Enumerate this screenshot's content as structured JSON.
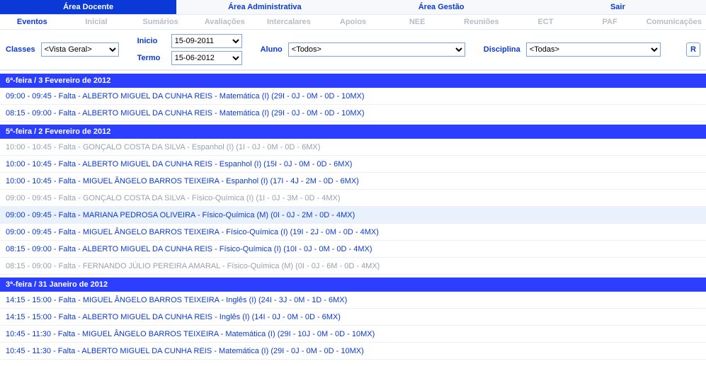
{
  "topnav": [
    {
      "label": "Área Docente",
      "active": true
    },
    {
      "label": "Área Administrativa",
      "active": false
    },
    {
      "label": "Área Gestão",
      "active": false
    },
    {
      "label": "Sair",
      "active": false
    }
  ],
  "subnav": [
    {
      "label": "Eventos",
      "active": true
    },
    {
      "label": "Inicial",
      "active": false
    },
    {
      "label": "Sumários",
      "active": false
    },
    {
      "label": "Avaliações",
      "active": false
    },
    {
      "label": "Intercalares",
      "active": false
    },
    {
      "label": "Apoios",
      "active": false
    },
    {
      "label": "NEE",
      "active": false
    },
    {
      "label": "Reuniões",
      "active": false
    },
    {
      "label": "ECT",
      "active": false
    },
    {
      "label": "PAF",
      "active": false
    },
    {
      "label": "Comunicações",
      "active": false
    }
  ],
  "filters": {
    "classes_label": "Classes",
    "classes_value": "<Vista Geral>",
    "inicio_label": "Inicio",
    "inicio_value": "15-09-2011",
    "termo_label": "Termo",
    "termo_value": "15-06-2012",
    "aluno_label": "Aluno",
    "aluno_value": "<Todos>",
    "disciplina_label": "Disciplina",
    "disciplina_value": "<Todas>",
    "refresh_label": "R"
  },
  "days": [
    {
      "header": "6ª-feira / 3 Fevereiro de 2012",
      "entries": [
        {
          "text": "09:00 - 09:45 - Falta - ALBERTO MIGUEL DA CUNHA REIS - Matemática (I) (29I - 0J - 0M - 0D - 10MX)",
          "muted": false,
          "hover": false
        },
        {
          "text": "08:15 - 09:00 - Falta - ALBERTO MIGUEL DA CUNHA REIS - Matemática (I) (29I - 0J - 0M - 0D - 10MX)",
          "muted": false,
          "hover": false
        }
      ]
    },
    {
      "header": "5ª-feira / 2 Fevereiro de 2012",
      "entries": [
        {
          "text": "10:00 - 10:45 - Falta - GONÇALO COSTA DA SILVA - Espanhol (I) (1I - 0J - 0M - 0D - 6MX)",
          "muted": true,
          "hover": false
        },
        {
          "text": "10:00 - 10:45 - Falta - ALBERTO MIGUEL DA CUNHA REIS - Espanhol (I) (15I - 0J - 0M - 0D - 6MX)",
          "muted": false,
          "hover": false
        },
        {
          "text": "10:00 - 10:45 - Falta - MIGUEL ÂNGELO BARROS TEIXEIRA - Espanhol (I) (17I - 4J - 2M - 0D - 6MX)",
          "muted": false,
          "hover": false
        },
        {
          "text": "09:00 - 09:45 - Falta - GONÇALO COSTA DA SILVA - Físico-Química (I) (1I - 0J - 3M - 0D - 4MX)",
          "muted": true,
          "hover": false
        },
        {
          "text": "09:00 - 09:45 - Falta - MARIANA PEDROSA OLIVEIRA - Físico-Química (M) (0I - 0J - 2M - 0D - 4MX)",
          "muted": false,
          "hover": true
        },
        {
          "text": "09:00 - 09:45 - Falta - MIGUEL ÂNGELO BARROS TEIXEIRA - Físico-Química (I) (19I - 2J - 0M - 0D - 4MX)",
          "muted": false,
          "hover": false
        },
        {
          "text": "08:15 - 09:00 - Falta - ALBERTO MIGUEL DA CUNHA REIS - Físico-Química (I) (10I - 0J - 0M - 0D - 4MX)",
          "muted": false,
          "hover": false
        },
        {
          "text": "08:15 - 09:00 - Falta - FERNANDO JÚLIO PEREIRA AMARAL - Físico-Química (M) (0I - 0J - 6M - 0D - 4MX)",
          "muted": true,
          "hover": false
        }
      ]
    },
    {
      "header": "3ª-feira / 31 Janeiro de 2012",
      "entries": [
        {
          "text": "14:15 - 15:00 - Falta - MIGUEL ÂNGELO BARROS TEIXEIRA - Inglês (I) (24I - 3J - 0M - 1D - 6MX)",
          "muted": false,
          "hover": false
        },
        {
          "text": "14:15 - 15:00 - Falta - ALBERTO MIGUEL DA CUNHA REIS - Inglês (I) (14I - 0J - 0M - 0D - 6MX)",
          "muted": false,
          "hover": false
        },
        {
          "text": "10:45 - 11:30 - Falta - MIGUEL ÂNGELO BARROS TEIXEIRA - Matemática (I) (29I - 10J - 0M - 0D - 10MX)",
          "muted": false,
          "hover": false
        },
        {
          "text": "10:45 - 11:30 - Falta - ALBERTO MIGUEL DA CUNHA REIS - Matemática (I) (29I - 0J - 0M - 0D - 10MX)",
          "muted": false,
          "hover": false
        }
      ]
    }
  ]
}
